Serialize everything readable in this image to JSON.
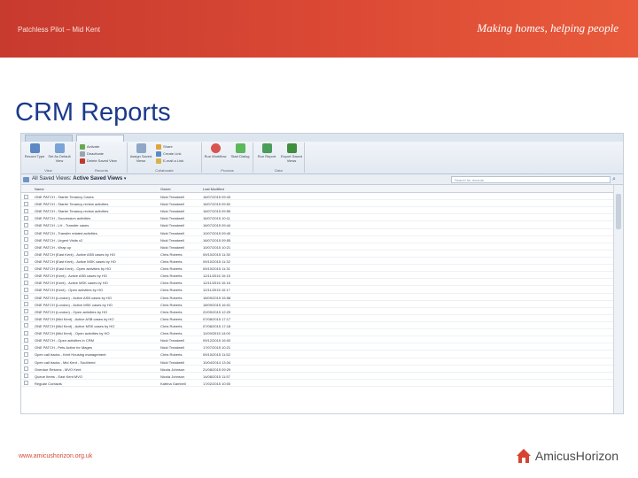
{
  "header": {
    "left": "Patchless Pilot – Mid Kent",
    "tagline": "Making homes, helping people"
  },
  "title": "CRM Reports",
  "ribbon": {
    "groups": [
      {
        "label": "View",
        "buttons": [
          "Record Type",
          "Set As Default View"
        ]
      },
      {
        "label": "Records",
        "items": [
          "Activate",
          "Deactivate",
          "Delete Saved View"
        ]
      },
      {
        "label": "Collaborate",
        "buttons": [
          "Assign Saved Views"
        ],
        "items": [
          "Share",
          "Create Link",
          "E-mail a Link"
        ]
      },
      {
        "label": "Process",
        "buttons": [
          "Run Workflow",
          "Start Dialog"
        ]
      },
      {
        "label": "Data",
        "buttons": [
          "Run Report",
          "Export Saved Views"
        ]
      }
    ]
  },
  "view": {
    "title": "All Saved Views:",
    "selected": "Active Saved Views",
    "search_placeholder": "Search for records"
  },
  "columns": [
    "Name",
    "Owner",
    "Last Modified"
  ],
  "rows": [
    [
      "ONE PATCH - Starter Tenancy Cases",
      "Nicki Treadwell",
      "16/07/2015 09:43"
    ],
    [
      "ONE PATCH - Starter Tenancy review activities",
      "Nicki Treadwell",
      "16/07/2015 09:52"
    ],
    [
      "ONE PATCH - Starter Tenancy review activities",
      "Nicki Treadwell",
      "16/07/2015 09:55"
    ],
    [
      "ONE PATCH - Succession activities",
      "Nicki Treadwell",
      "16/07/2015 10:11"
    ],
    [
      "ONE PATCH - LH - Transfer cases",
      "Nicki Treadwell",
      "16/07/2015 09:44"
    ],
    [
      "ONE PATCH - Transfer related activities",
      "Nicki Treadwell",
      "10/07/2015 09:40"
    ],
    [
      "ONE PATCH - Urgent Visits x2",
      "Nicki Treadwell",
      "16/07/2015 09:55"
    ],
    [
      "ONE PATCH - Wrap up",
      "Nicki Treadwell",
      "10/07/2015 10:21"
    ],
    [
      "ONE PATCH (East Kent) - Active ASB cases by HO",
      "Chris Roberts",
      "09/10/2015 11:30"
    ],
    [
      "ONE PATCH (East Kent) - Active MSK cases by HO",
      "Chris Roberts",
      "09/10/2015 11:32"
    ],
    [
      "ONE PATCH (East Kent) - Open activities by HO",
      "Chris Roberts",
      "09/10/2015 11:31"
    ],
    [
      "ONE PATCH (Kent) - Active ASB cases by HO",
      "Chris Roberts",
      "12/11/2015 10:15"
    ],
    [
      "ONE PATCH (Kent) - Active MSK cases by HO",
      "Chris Roberts",
      "12/11/2015 10:16"
    ],
    [
      "ONE PATCH (Kent) - Open activities by HO",
      "Chris Roberts",
      "12/11/2015 10:17"
    ],
    [
      "ONE PATCH (London) - Active ASB cases by HO",
      "Chris Roberts",
      "18/09/2015 15:58"
    ],
    [
      "ONE PATCH (London) - Active MSK cases by HO",
      "Chris Roberts",
      "18/09/2015 16:01"
    ],
    [
      "ONE PATCH (London) - Open activities by HO",
      "Chris Roberts",
      "22/09/2015 12:29"
    ],
    [
      "ONE PATCH (Mid Kent) - Active ASB cases by HO",
      "Chris Roberts",
      "07/08/2015 17:17"
    ],
    [
      "ONE PATCH (Mid Kent) - Active MSK cases by HO",
      "Chris Roberts",
      "07/08/2015 17:18"
    ],
    [
      "ONE PATCH (Mid Kent) - Open activities by HO",
      "Chris Roberts",
      "11/09/2015 14:00"
    ],
    [
      "ONE PATCH - Open activities in CRM",
      "Nicki Treadwell",
      "09/12/2015 16:00"
    ],
    [
      "ONE PATCH - Pets Active for Mages",
      "Nicki Treadwell",
      "17/07/2015 10:21"
    ],
    [
      "Open call backs - Kent Housing management",
      "Chris Roberts",
      "09/10/2015 11:52"
    ],
    [
      "Open call backs - Mid Kent - Southend",
      "Nicki Treadwell",
      "10/04/2014 13:34"
    ],
    [
      "Overdue Returns - MVO Kent",
      "Nicola Johnson",
      "21/08/2015 09:29"
    ],
    [
      "Queue Items - East Kent MVO",
      "Nicola Johnson",
      "14/08/2015 11:57"
    ],
    [
      "Regular Contacts",
      "Katrina Gambrill",
      "17/02/2015 10:00"
    ]
  ],
  "footer": {
    "url": "www.amicushorizon.org.uk",
    "logo": "AmicusHorizon"
  },
  "colors": {
    "brand": "#d64330",
    "title": "#1b3a8c"
  }
}
